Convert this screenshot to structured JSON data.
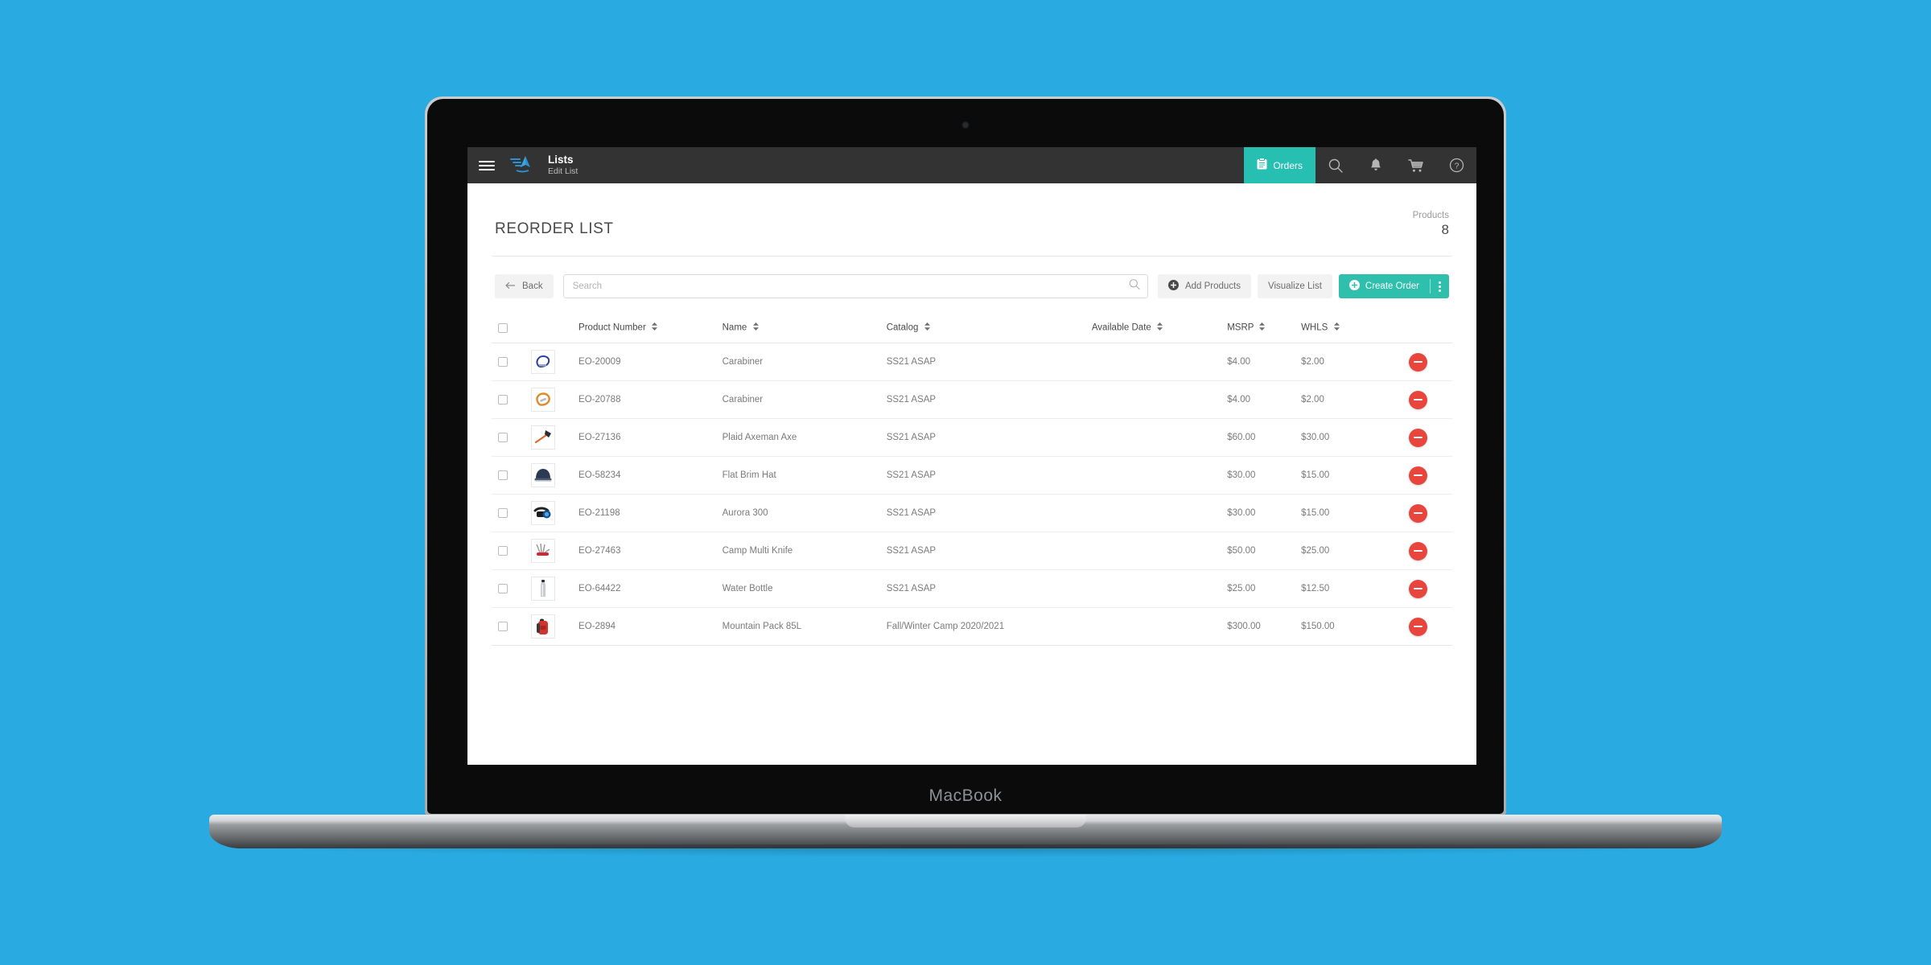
{
  "device": {
    "label": "MacBook"
  },
  "header": {
    "menu_icon": "hamburger-menu-icon",
    "logo_icon": "brand-logo-icon",
    "title": "Lists",
    "subtitle": "Edit List",
    "orders_label": "Orders",
    "orders_icon": "clipboard-icon",
    "accent_color": "#26bfb2",
    "icons": [
      "search-icon",
      "bell-icon",
      "cart-icon",
      "help-icon"
    ]
  },
  "page": {
    "title": "REORDER LIST",
    "products_label": "Products",
    "products_count": "8"
  },
  "toolbar": {
    "back_label": "Back",
    "back_icon": "arrow-left-icon",
    "search_value": "",
    "search_placeholder": "Search",
    "search_icon": "search-icon",
    "add_products_label": "Add Products",
    "add_products_icon": "plus-circle-icon",
    "visualize_list_label": "Visualize List",
    "create_order_label": "Create Order",
    "create_order_icon": "plus-circle-icon",
    "create_order_kebab_icon": "kebab-menu-icon",
    "create_order_color": "#2fbfad"
  },
  "table": {
    "columns": [
      {
        "label": "",
        "key": "check"
      },
      {
        "label": "",
        "key": "thumb"
      },
      {
        "label": "Product Number",
        "key": "product_number",
        "sortable": true
      },
      {
        "label": "Name",
        "key": "name",
        "sortable": true
      },
      {
        "label": "Catalog",
        "key": "catalog",
        "sortable": true
      },
      {
        "label": "Available Date",
        "key": "available_date",
        "sortable": true
      },
      {
        "label": "MSRP",
        "key": "msrp",
        "sortable": true
      },
      {
        "label": "WHLS",
        "key": "whls",
        "sortable": true
      },
      {
        "label": "",
        "key": "action"
      }
    ],
    "rows": [
      {
        "product_number": "EO-20009",
        "name": "Carabiner",
        "catalog": "SS21 ASAP",
        "available_date": "",
        "msrp": "$4.00",
        "whls": "$2.00",
        "thumb": "carabiner-blue-icon",
        "selected": false
      },
      {
        "product_number": "EO-20788",
        "name": "Carabiner",
        "catalog": "SS21 ASAP",
        "available_date": "",
        "msrp": "$4.00",
        "whls": "$2.00",
        "thumb": "carabiner-orange-icon",
        "selected": false
      },
      {
        "product_number": "EO-27136",
        "name": "Plaid Axeman Axe",
        "catalog": "SS21 ASAP",
        "available_date": "",
        "msrp": "$60.00",
        "whls": "$30.00",
        "thumb": "axe-icon",
        "selected": false
      },
      {
        "product_number": "EO-58234",
        "name": "Flat Brim Hat",
        "catalog": "SS21 ASAP",
        "available_date": "",
        "msrp": "$30.00",
        "whls": "$15.00",
        "thumb": "hat-icon",
        "selected": false
      },
      {
        "product_number": "EO-21198",
        "name": "Aurora 300",
        "catalog": "SS21 ASAP",
        "available_date": "",
        "msrp": "$30.00",
        "whls": "$15.00",
        "thumb": "headlamp-icon",
        "selected": false
      },
      {
        "product_number": "EO-27463",
        "name": "Camp Multi Knife",
        "catalog": "SS21 ASAP",
        "available_date": "",
        "msrp": "$50.00",
        "whls": "$25.00",
        "thumb": "multitool-icon",
        "selected": false
      },
      {
        "product_number": "EO-64422",
        "name": "Water Bottle",
        "catalog": "SS21 ASAP",
        "available_date": "",
        "msrp": "$25.00",
        "whls": "$12.50",
        "thumb": "bottle-icon",
        "selected": false
      },
      {
        "product_number": "EO-2894",
        "name": "Mountain Pack 85L",
        "catalog": "Fall/Winter Camp 2020/2021",
        "available_date": "",
        "msrp": "$300.00",
        "whls": "$150.00",
        "thumb": "backpack-icon",
        "selected": false
      }
    ],
    "remove_icon": "minus-circle-icon",
    "remove_color": "#e8453c"
  },
  "background_color": "#29ABE2"
}
